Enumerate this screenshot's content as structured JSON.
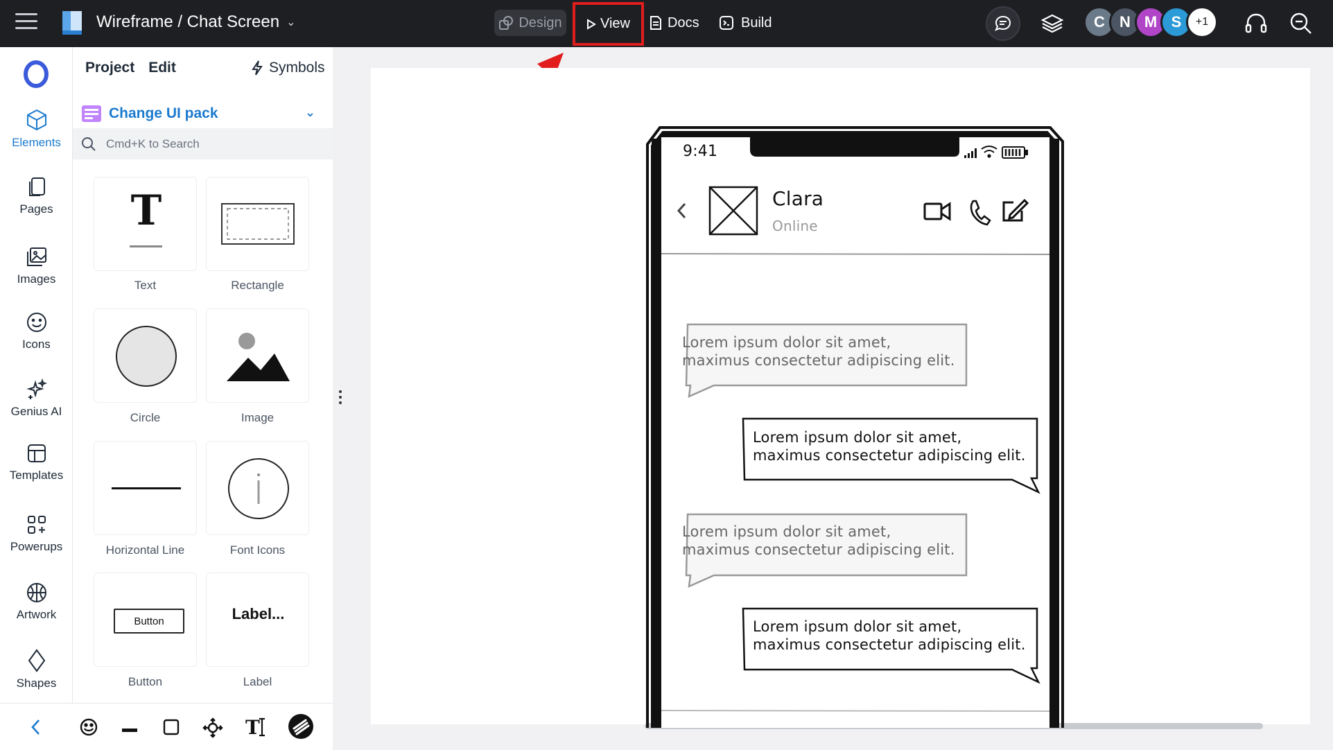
{
  "topbar": {
    "title": "Wireframe / Chat Screen",
    "design_label": "Design",
    "view_label": "View",
    "docs_label": "Docs",
    "build_label": "Build",
    "avatars": [
      {
        "initial": "C",
        "color": "#6b7a88"
      },
      {
        "initial": "N",
        "color": "#4b5563"
      },
      {
        "initial": "M",
        "color": "#b046c7"
      },
      {
        "initial": "S",
        "color": "#2b9ad6"
      }
    ],
    "extra_collaborators": "+1"
  },
  "rail": {
    "items": [
      {
        "label": "Elements",
        "icon": "cube-icon",
        "active": true
      },
      {
        "label": "Pages",
        "icon": "pages-icon"
      },
      {
        "label": "Images",
        "icon": "images-icon"
      },
      {
        "label": "Icons",
        "icon": "smiley-icon"
      },
      {
        "label": "Genius AI",
        "icon": "sparkle-icon"
      },
      {
        "label": "Templates",
        "icon": "templates-icon"
      },
      {
        "label": "Powerups",
        "icon": "powerups-icon"
      },
      {
        "label": "Artwork",
        "icon": "artwork-icon"
      },
      {
        "label": "Shapes",
        "icon": "diamond-icon"
      }
    ]
  },
  "panel": {
    "tab_project": "Project",
    "tab_edit": "Edit",
    "symbols_label": "Symbols",
    "ui_pack_label": "Change UI pack",
    "search_placeholder": "Cmd+K to Search",
    "tiles": [
      {
        "label": "Text"
      },
      {
        "label": "Rectangle"
      },
      {
        "label": "Circle"
      },
      {
        "label": "Image"
      },
      {
        "label": "Horizontal Line"
      },
      {
        "label": "Font Icons"
      },
      {
        "label": "Button",
        "preview": "Button"
      },
      {
        "label": "Label",
        "preview": "Label..."
      }
    ]
  },
  "phone": {
    "time": "9:41",
    "contact_name": "Clara",
    "contact_status": "Online",
    "messages": [
      {
        "line1": "Lorem ipsum dolor sit amet,",
        "line2": "maximus consectetur adipiscing elit.",
        "side": "left"
      },
      {
        "line1": "Lorem ipsum dolor sit amet,",
        "line2": "maximus consectetur adipiscing elit.",
        "side": "right"
      },
      {
        "line1": "Lorem ipsum dolor sit amet,",
        "line2": "maximus consectetur adipiscing elit.",
        "side": "left"
      },
      {
        "line1": "Lorem ipsum dolor sit amet,",
        "line2": "maximus consectetur adipiscing elit.",
        "side": "right"
      }
    ]
  },
  "colors": {
    "accent": "#1b7bcf",
    "highlight": "#e21d1d",
    "topbar_bg": "#1e1f23"
  }
}
